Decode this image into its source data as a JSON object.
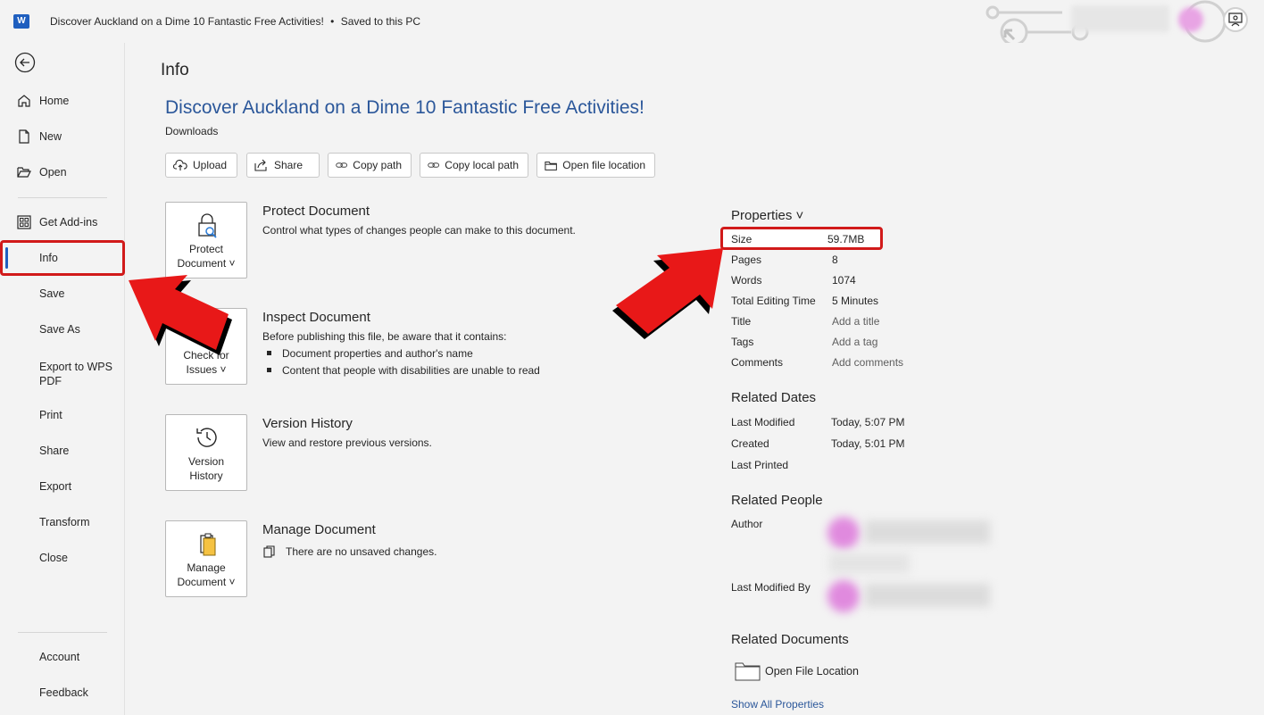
{
  "titlebar": {
    "app_logo": "W",
    "doc_name": "Discover Auckland on a Dime 10 Fantastic Free Activities!",
    "separator": "•",
    "save_status": "Saved to this PC"
  },
  "sidebar": {
    "back_icon": "back-arrow-icon",
    "items": [
      {
        "label": "Home",
        "icon": "home-icon"
      },
      {
        "label": "New",
        "icon": "new-document-icon"
      },
      {
        "label": "Open",
        "icon": "folder-open-icon"
      },
      {
        "label": "Get Add-ins",
        "icon": "add-ins-grid-icon"
      },
      {
        "label": "Info"
      },
      {
        "label": "Save"
      },
      {
        "label": "Save As"
      },
      {
        "label": "Export to WPS PDF"
      },
      {
        "label": "Print"
      },
      {
        "label": "Share"
      },
      {
        "label": "Export"
      },
      {
        "label": "Transform"
      },
      {
        "label": "Close"
      },
      {
        "label": "Account"
      },
      {
        "label": "Feedback"
      }
    ],
    "selected": "Info"
  },
  "main": {
    "page_title": "Info",
    "doc_title": "Discover Auckland on a Dime 10 Fantastic Free Activities!",
    "doc_location": "Downloads",
    "buttons": [
      {
        "label": "Upload",
        "icon": "cloud-upload-icon"
      },
      {
        "label": "Share",
        "icon": "share-icon"
      },
      {
        "label": "Copy path",
        "icon": "link-icon"
      },
      {
        "label": "Copy local path",
        "icon": "link-icon"
      },
      {
        "label": "Open file location",
        "icon": "folder-icon"
      }
    ],
    "sections": {
      "protect": {
        "card_label_1": "Protect",
        "card_label_2": "Document ˅",
        "heading": "Protect Document",
        "description": "Control what types of changes people can make to this document."
      },
      "inspect": {
        "card_label_1": "Check for",
        "card_label_2": "Issues ˅",
        "heading": "Inspect Document",
        "description": "Before publishing this file, be aware that it contains:",
        "bullets": [
          "Document properties and author's name",
          "Content that people with disabilities are unable to read"
        ]
      },
      "version": {
        "card_label_1": "Version",
        "card_label_2": "History",
        "heading": "Version History",
        "description": "View and restore previous versions."
      },
      "manage": {
        "card_label_1": "Manage",
        "card_label_2": "Document ˅",
        "heading": "Manage Document",
        "description": "There are no unsaved changes."
      }
    }
  },
  "properties": {
    "heading": "Properties ˅",
    "size_label": "Size",
    "size_value": "59.7MB",
    "rows": [
      {
        "label": "Pages",
        "value": "8"
      },
      {
        "label": "Words",
        "value": "1074"
      },
      {
        "label": "Total Editing Time",
        "value": "5 Minutes"
      },
      {
        "label": "Title",
        "value": "Add a title"
      },
      {
        "label": "Tags",
        "value": "Add a tag"
      },
      {
        "label": "Comments",
        "value": "Add comments"
      }
    ],
    "related_dates": {
      "heading": "Related Dates",
      "rows": [
        {
          "label": "Last Modified",
          "value": "Today, 5:07 PM"
        },
        {
          "label": "Created",
          "value": "Today, 5:01 PM"
        },
        {
          "label": "Last Printed",
          "value": ""
        }
      ]
    },
    "related_people": {
      "heading": "Related People",
      "author_label": "Author",
      "last_modified_by_label": "Last Modified By"
    },
    "related_documents": {
      "heading": "Related Documents",
      "open_file_location": "Open File Location"
    },
    "show_all": "Show All Properties"
  },
  "annotations": {
    "highlight_color": "#d11a1a",
    "accent_color": "#2b579a"
  }
}
